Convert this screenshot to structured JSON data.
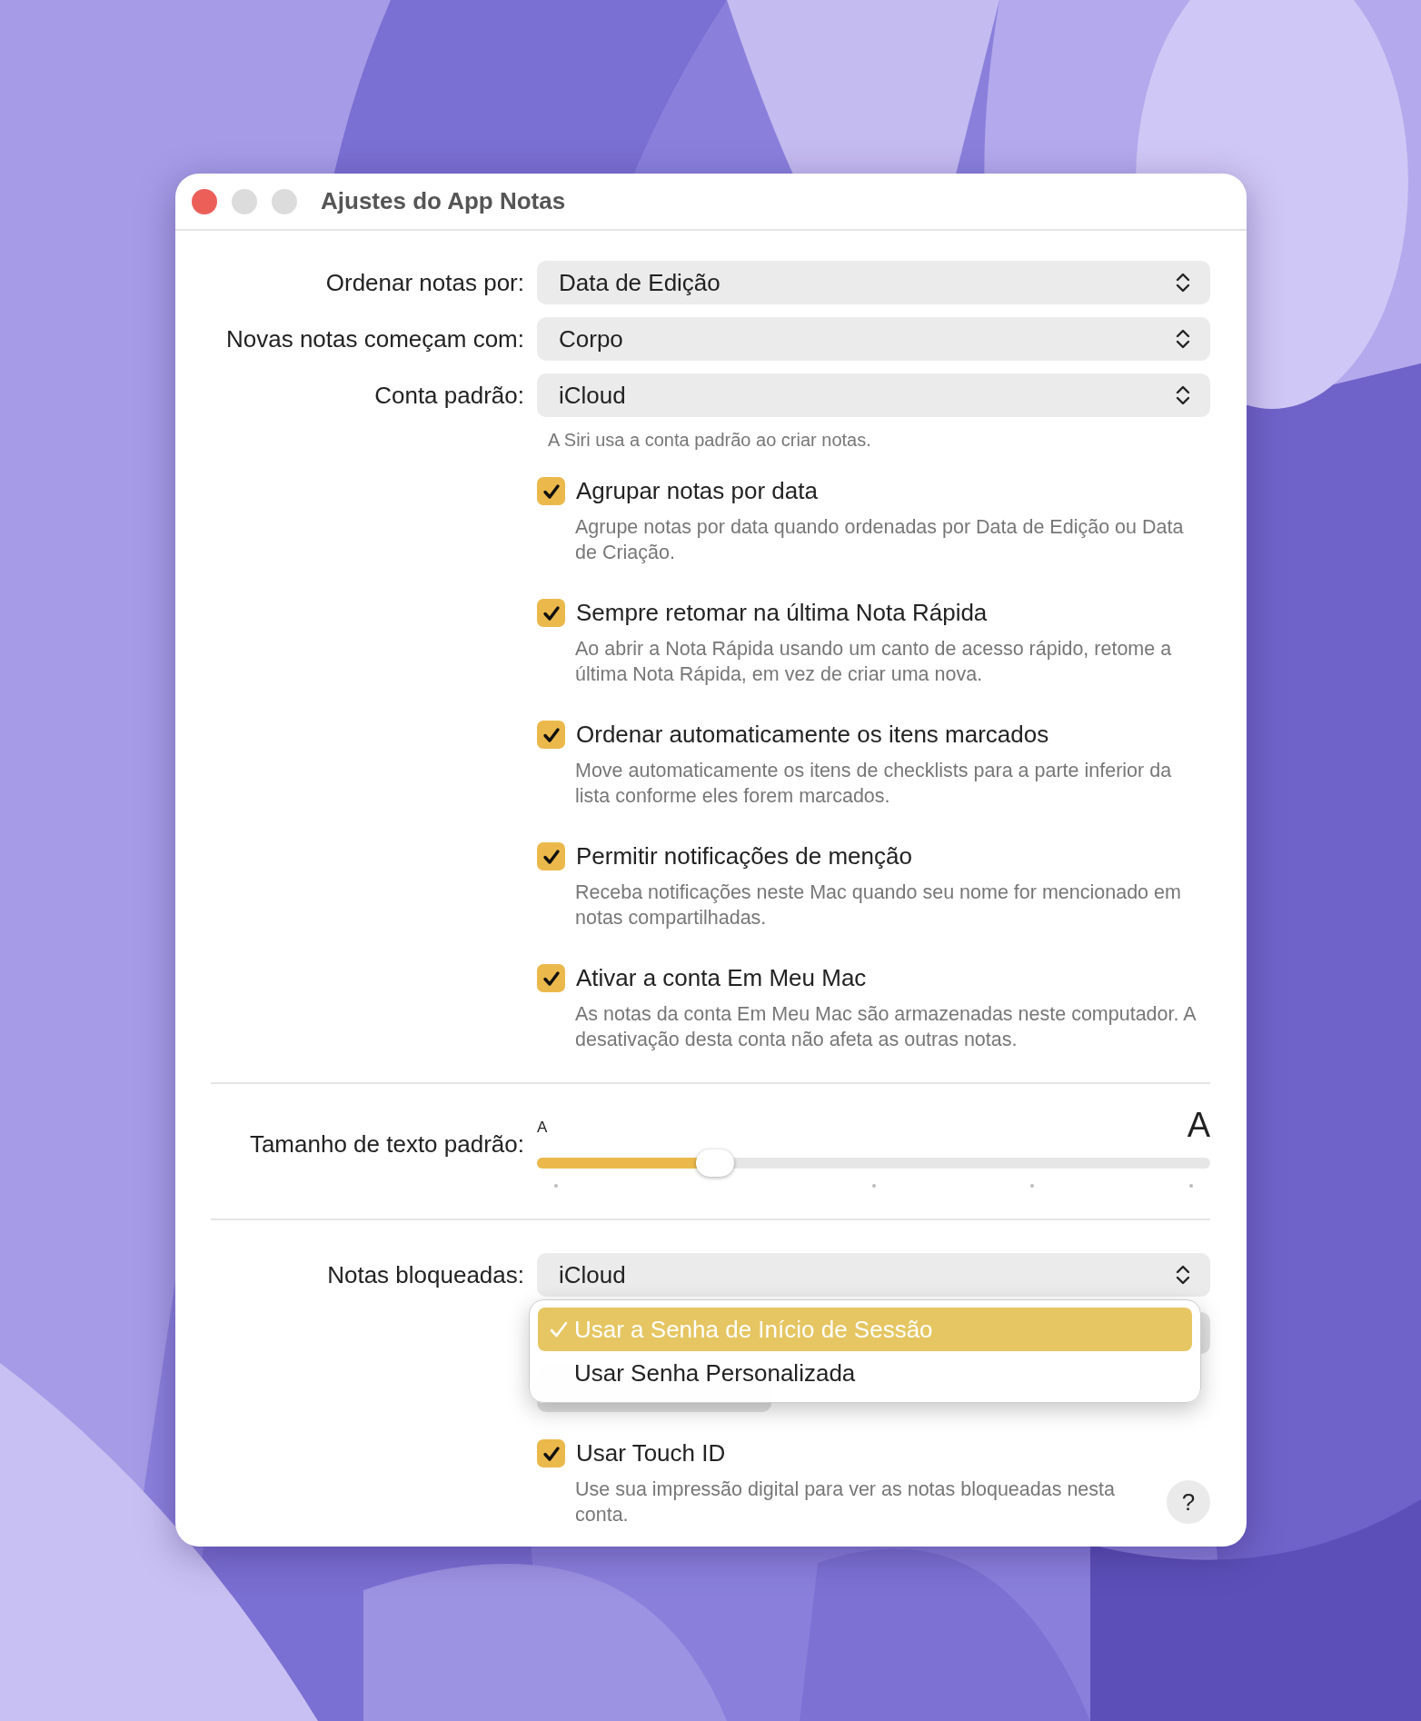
{
  "window": {
    "title": "Ajustes do App Notas"
  },
  "popups": [
    {
      "label": "Ordenar notas por:",
      "value": "Data de Edição"
    },
    {
      "label": "Novas notas começam com:",
      "value": "Corpo"
    },
    {
      "label": "Conta padrão:",
      "value": "iCloud"
    }
  ],
  "note": "A Siri usa a conta padrão ao criar notas.",
  "options": [
    {
      "label": "Agrupar notas por data",
      "description": "Agrupe notas por data quando ordenadas por Data de Edição ou Data de Criação.",
      "checked": true
    },
    {
      "label": "Sempre retomar na última Nota Rápida",
      "description": "Ao abrir a Nota Rápida usando um canto de acesso rápido, retome a última Nota Rápida, em vez de criar uma nova.",
      "checked": true
    },
    {
      "label": "Ordenar automaticamente os itens marcados",
      "description": "Move automaticamente os itens de checklists para a parte inferior da lista conforme eles forem marcados.",
      "checked": true
    },
    {
      "label": "Permitir notificações de menção",
      "description": "Receba notificações neste Mac quando seu nome for mencionado em notas compartilhadas.",
      "checked": true
    },
    {
      "label": "Ativar a conta Em Meu Mac",
      "description": "As notas da conta Em Meu Mac são armazenadas neste computador. A desativação desta conta não afeta as outras notas.",
      "checked": true
    }
  ],
  "text_size": {
    "label": "Tamanho de texto padrão:",
    "small_glyph": "A",
    "large_glyph": "A",
    "level": 0.265
  },
  "locked_notes": {
    "label": "Notas bloqueadas:",
    "value": "iCloud"
  },
  "menu": [
    {
      "label": "Usar a Senha de Início de Sessão",
      "selected": true
    },
    {
      "label": "Usar Senha Personalizada",
      "selected": false
    }
  ],
  "touch_id": {
    "label": "Usar Touch ID",
    "description": "Use sua impressão digital para ver as notas bloqueadas nesta conta.",
    "checked": true
  },
  "help": "?"
}
